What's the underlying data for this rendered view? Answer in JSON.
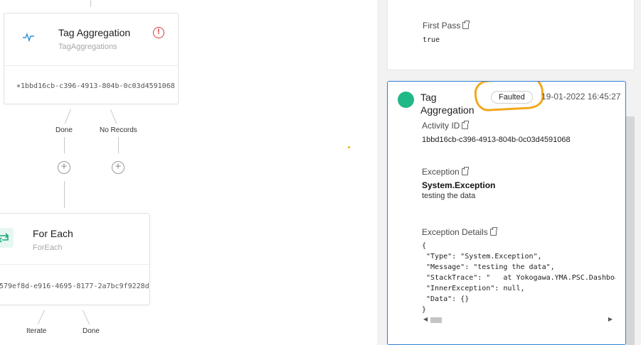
{
  "canvas": {
    "nodes": [
      {
        "title": "Tag Aggregation",
        "subtitle": "TagAggregations",
        "id": "1bbd16cb-c396-4913-804b-0c03d4591068",
        "icon": "activity-pulse-icon",
        "status_icon": "error-exclamation-icon"
      },
      {
        "title": "For Each",
        "subtitle": "ForEach",
        "id": "579ef8d-e916-4695-8177-2a7bc9f9228d",
        "icon": "loop-icon"
      }
    ],
    "edges": {
      "tag_done": "Done",
      "tag_no_records": "No Records",
      "foreach_iterate": "Iterate",
      "foreach_done": "Done"
    },
    "add_glyph": "+"
  },
  "panel": {
    "previous": {
      "label": "First Pass",
      "value": "true"
    },
    "active": {
      "title_line1": "Tag",
      "title_line2": "Aggregation",
      "status": "Faulted",
      "timestamp": "19-01-2022 16:45:27",
      "activity_id_label": "Activity ID",
      "activity_id": "1bbd16cb-c396-4913-804b-0c03d4591068",
      "exception_label": "Exception",
      "exception_name": "System.Exception",
      "exception_message": "testing the data",
      "details_label": "Exception Details",
      "details_code": "{\n \"Type\": \"System.Exception\",\n \"Message\": \"testing the data\",\n \"StackTrace\": \"   at Yokogawa.YMA.PSC.Dashboar\n \"InnerException\": null,\n \"Data\": {}\n}"
    },
    "colors": {
      "accent": "#2f7fd6",
      "success": "#20b886",
      "highlight": "#f2a81b",
      "error": "#d23b3b"
    }
  }
}
